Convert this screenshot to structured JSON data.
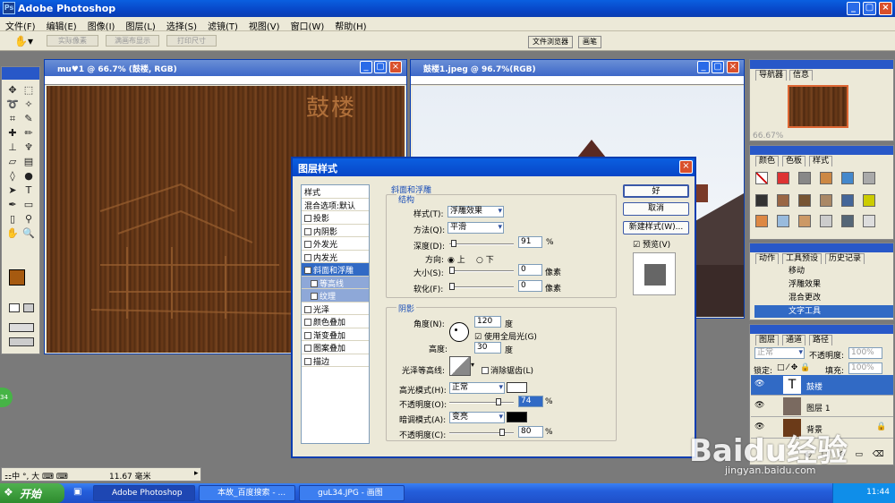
{
  "app": {
    "title": "Adobe Photoshop"
  },
  "menu": [
    "文件(F)",
    "编辑(E)",
    "图像(I)",
    "图层(L)",
    "选择(S)",
    "滤镜(T)",
    "视图(V)",
    "窗口(W)",
    "帮助(H)"
  ],
  "options": {
    "actual_pixels": "实际像素",
    "fit_screen": "满画布显示",
    "print_size": "打印尺寸"
  },
  "palette_well": {
    "file_browser": "文件浏览器",
    "brushes": "画笔"
  },
  "doc1": {
    "title": "mu♥1 @ 66.7% (鼓楼, RGB)",
    "watermark": "鼓楼"
  },
  "doc2": {
    "title": "鼓楼1.jpeg @ 96.7%(RGB)"
  },
  "dialog": {
    "title": "图层样式",
    "left_items": [
      "样式",
      "混合选项:默认",
      "投影",
      "内阴影",
      "外发光",
      "内发光",
      "斜面和浮雕",
      "等高线",
      "纹理",
      "光泽",
      "颜色叠加",
      "渐变叠加",
      "图案叠加",
      "描边"
    ],
    "bevel": {
      "group": "斜面和浮雕",
      "structure": "结构",
      "style_label": "样式(T):",
      "style_value": "浮雕效果",
      "technique_label": "方法(Q):",
      "technique_value": "平滑",
      "depth_label": "深度(D):",
      "depth_value": "91",
      "depth_unit": "%",
      "direction_label": "方向:",
      "dir_up": "上",
      "dir_down": "下",
      "size_label": "大小(S):",
      "size_value": "0",
      "size_unit": "像素",
      "soften_label": "软化(F):",
      "soften_value": "0",
      "soften_unit": "像素"
    },
    "shading": {
      "group": "阴影",
      "angle_label": "角度(N):",
      "angle_value": "120",
      "angle_unit": "度",
      "global_light": "使用全局光(G)",
      "altitude_label": "高度:",
      "altitude_value": "30",
      "altitude_unit": "度",
      "gloss_label": "光泽等高线:",
      "antialias": "消除锯齿(L)",
      "highlight_label": "高光模式(H):",
      "highlight_value": "正常",
      "hl_opacity_label": "不透明度(O):",
      "hl_opacity_value": "74",
      "pct": "%",
      "shadow_label": "暗调模式(A):",
      "shadow_value": "变亮",
      "sh_opacity_label": "不透明度(C):",
      "sh_opacity_value": "80"
    },
    "buttons": {
      "ok": "好",
      "cancel": "取消",
      "new_style": "新建样式(W)...",
      "preview": "预览(V)"
    }
  },
  "navigator": {
    "tab1": "导航器",
    "tab2": "信息",
    "zoom": "66.67%"
  },
  "swatches": {
    "tab1": "颜色",
    "tab2": "色板",
    "tab3": "样式"
  },
  "history": {
    "tab1": "动作",
    "tab2": "工具预设",
    "tab3": "历史记录",
    "items": [
      "移动",
      "浮雕效果",
      "混合更改",
      "文字工具"
    ]
  },
  "layers": {
    "tab1": "图层",
    "tab2": "通道",
    "tab3": "路径",
    "mode": "正常",
    "opacity_label": "不透明度:",
    "opacity_value": "100%",
    "lock_label": "锁定:",
    "fill_label": "填充:",
    "fill_value": "100%",
    "rows": [
      "鼓楼",
      "图层 1",
      "背景"
    ]
  },
  "status": {
    "value": "11.67 毫米",
    "ime": "中"
  },
  "taskbar": {
    "start": "开始",
    "tasks": [
      "Adobe Photoshop",
      "本故_百度搜索 - ...",
      "guL34.JPG - 画图"
    ],
    "time": "11:44"
  },
  "watermark": {
    "brand": "Baidu经验",
    "url": "jingyan.baidu.com"
  },
  "colors": {
    "title": "#0846c7",
    "wood": "#6b3a18",
    "selection": "#316ac5"
  }
}
